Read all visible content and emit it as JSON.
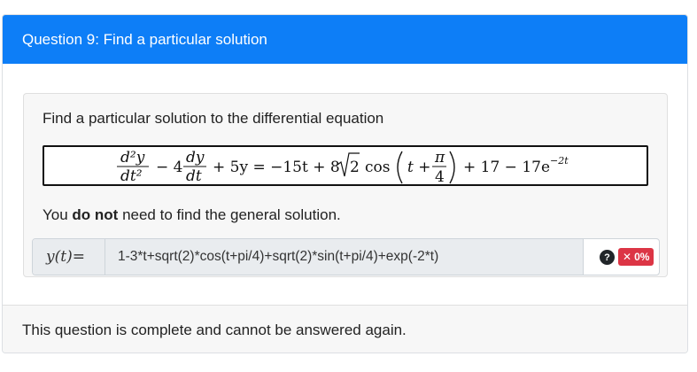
{
  "header": {
    "title": "Question 9: Find a particular solution"
  },
  "question": {
    "prompt": "Find a particular solution to the differential equation",
    "note_before": "You ",
    "note_bold": "do not",
    "note_after": " need to find the general solution."
  },
  "equation": {
    "d2y": "d²y",
    "dt2": "dt²",
    "minus4": "− 4",
    "dy": "dy",
    "dt": "dt",
    "mid": "+ 5y = −15t + 8",
    "sqrt2": "2",
    "cos": "cos",
    "t_plus": "t +",
    "pi": "π",
    "four": "4",
    "tail": "+ 17 − 17e",
    "exp": "−2t"
  },
  "answer": {
    "label_var": "y(t)",
    "label_eq": " =",
    "value": "1-3*t+sqrt(2)*cos(t+pi/4)+sqrt(2)*sin(t+pi/4)+exp(-2*t)",
    "help_icon": "?",
    "score_icon": "✕",
    "score": "0%"
  },
  "footer": {
    "status": "This question is complete and cannot be answered again."
  },
  "colors": {
    "header_bg": "#0d7ef7",
    "badge_bg": "#dc3545"
  }
}
